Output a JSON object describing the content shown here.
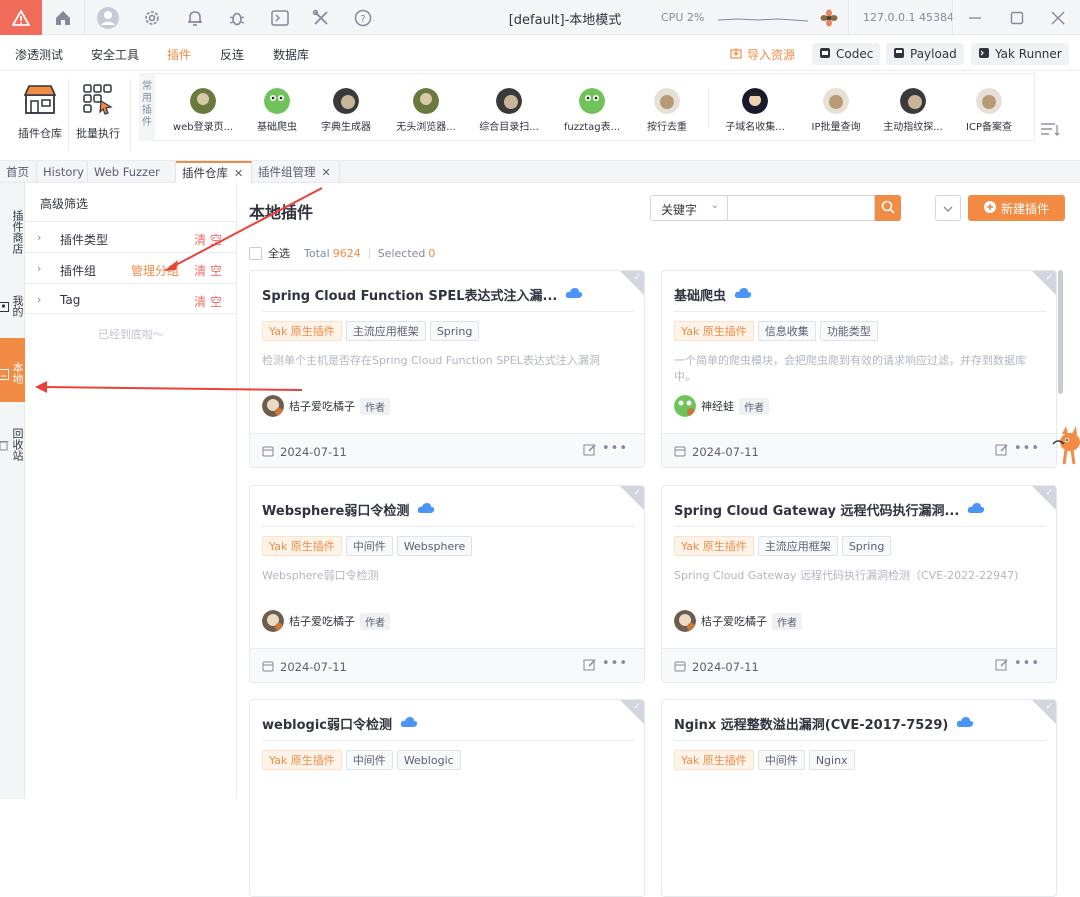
{
  "titlebar": {
    "title": "[default]-本地模式",
    "cpu": "CPU 2%",
    "ip_port": "127.0.0.1 45384"
  },
  "menubar": {
    "items": [
      "渗透测试",
      "安全工具",
      "插件",
      "反连",
      "数据库"
    ],
    "active_index": 2,
    "right_buttons": [
      "导入资源",
      "Codec",
      "Payload",
      "Yak Runner"
    ]
  },
  "toolbar": {
    "tools": [
      "插件仓库",
      "批量执行"
    ],
    "quick_label": "常用插件",
    "quick_plugins": [
      "web登录页...",
      "基础爬虫",
      "字典生成器",
      "无头浏览器...",
      "综合目录扫...",
      "fuzztag表...",
      "按行去重",
      "子域名收集...",
      "IP批量查询",
      "主动指纹探...",
      "ICP备案查"
    ]
  },
  "tabs": [
    {
      "label": "首页",
      "closable": false
    },
    {
      "label": "History",
      "closable": false
    },
    {
      "label": "Web Fuzzer",
      "closable": false
    },
    {
      "label": "插件仓库",
      "closable": true,
      "active": true
    },
    {
      "label": "插件组管理",
      "closable": true
    }
  ],
  "vstrip": [
    "插件商店",
    "我的",
    "本地",
    "回收站"
  ],
  "filter": {
    "title": "高级筛选",
    "rows": [
      {
        "name": "插件类型",
        "clear": "清 空"
      },
      {
        "name": "插件组",
        "manage": "管理分组",
        "clear": "清 空"
      },
      {
        "name": "Tag",
        "clear": "清 空"
      }
    ],
    "end_text": "已经到底啦～"
  },
  "main": {
    "title": "本地插件",
    "search_type": "关键字",
    "new_button": "新建插件",
    "select_all": "全选",
    "total_label": "Total",
    "total": "9624",
    "selected_label": "Selected",
    "selected": "0"
  },
  "cards": [
    {
      "title": "Spring Cloud Function SPEL表达式注入漏...",
      "tags": [
        "Yak 原生插件",
        "主流应用框架",
        "Spring"
      ],
      "desc": "检测单个主机是否存在Spring Cloud Function SPEL表达式注入漏洞",
      "author": "桔子爱吃橘子",
      "role": "作者",
      "date": "2024-07-11"
    },
    {
      "title": "基础爬虫",
      "tags": [
        "Yak 原生插件",
        "信息收集",
        "功能类型"
      ],
      "desc": "一个简单的爬虫模块，会把爬虫爬到有效的请求响应过滤，并存到数据库中。",
      "author": "神经蛙",
      "role": "作者",
      "date": "2024-07-11"
    },
    {
      "title": "Websphere弱口令检测",
      "tags": [
        "Yak 原生插件",
        "中间件",
        "Websphere"
      ],
      "desc": "Websphere弱口令检测",
      "author": "桔子爱吃橘子",
      "role": "作者",
      "date": "2024-07-11"
    },
    {
      "title": "Spring Cloud Gateway 远程代码执行漏洞...",
      "tags": [
        "Yak 原生插件",
        "主流应用框架",
        "Spring"
      ],
      "desc": "Spring Cloud Gateway 远程代码执行漏洞检测（CVE-2022-22947)",
      "author": "桔子爱吃橘子",
      "role": "作者",
      "date": "2024-07-11"
    },
    {
      "title": "weblogic弱口令检测",
      "tags": [
        "Yak 原生插件",
        "中间件",
        "Weblogic"
      ],
      "desc": "",
      "author": "",
      "role": "",
      "date": ""
    },
    {
      "title": "Nginx 远程整数溢出漏洞(CVE-2017-7529)",
      "tags": [
        "Yak 原生插件",
        "中间件",
        "Nginx"
      ],
      "desc": "",
      "author": "",
      "role": "",
      "date": ""
    }
  ],
  "colors": {
    "accent": "#f28b44",
    "danger": "#f46b64",
    "logo": "#f06b5a"
  }
}
